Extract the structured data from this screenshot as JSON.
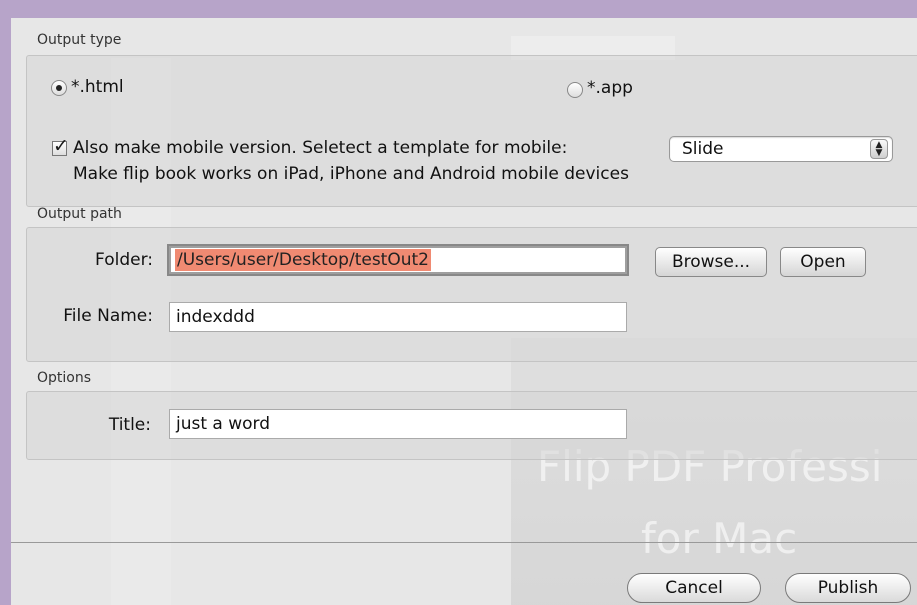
{
  "output_type": {
    "section_label": "Output type",
    "html_option": "*.html",
    "app_option": "*.app",
    "selected": "html",
    "mobile_checkbox_label": "Also make mobile version. Seletect a template for mobile:",
    "mobile_checked": true,
    "template_select_value": "Slide",
    "mobile_note": "Make flip book works on iPad, iPhone and Android mobile devices"
  },
  "output_path": {
    "section_label": "Output path",
    "folder_label": "Folder:",
    "folder_value": "/Users/user/Desktop/testOut2",
    "browse_button": "Browse...",
    "open_button": "Open",
    "file_name_label": "File Name:",
    "file_name_value": "indexddd"
  },
  "options": {
    "section_label": "Options",
    "title_label": "Title:",
    "title_value": "just a word"
  },
  "footer": {
    "cancel_button": "Cancel",
    "publish_button": "Publish"
  },
  "background": {
    "line1": "Flip PDF Professi",
    "line2": "for Mac"
  }
}
